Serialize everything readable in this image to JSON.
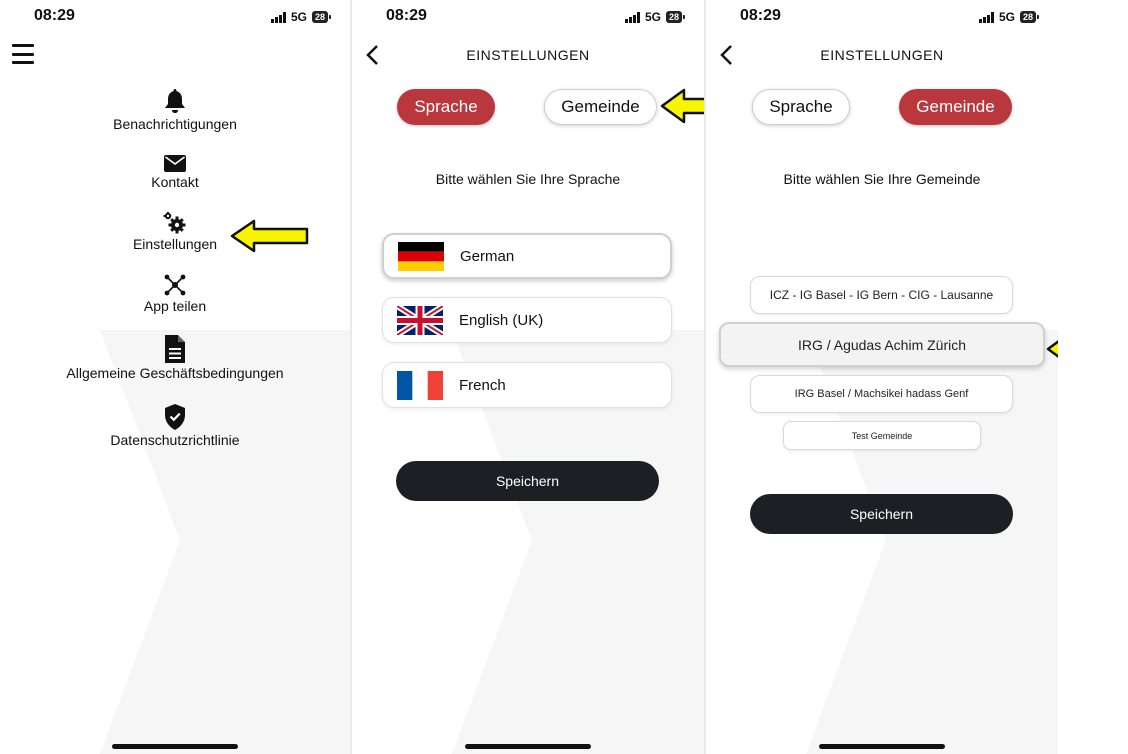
{
  "status_bar": {
    "time": "08:29",
    "network": "5G",
    "battery": "28"
  },
  "screen1": {
    "menu": [
      {
        "label": "Benachrichtigungen",
        "icon": "bell-icon"
      },
      {
        "label": "Kontakt",
        "icon": "envelope-icon"
      },
      {
        "label": "Einstellungen",
        "icon": "gears-icon"
      },
      {
        "label": "App teilen",
        "icon": "share-nodes-icon"
      },
      {
        "label": "Allgemeine Geschäftsbedingungen",
        "icon": "document-icon"
      },
      {
        "label": "Datenschutzrichtlinie",
        "icon": "shield-check-icon"
      }
    ]
  },
  "screen2": {
    "title": "EINSTELLUNGEN",
    "tabs": {
      "language": "Sprache",
      "community": "Gemeinde"
    },
    "prompt": "Bitte wählen Sie Ihre Sprache",
    "languages": [
      {
        "name": "German",
        "flag": "de-flag"
      },
      {
        "name": "English (UK)",
        "flag": "uk-flag"
      },
      {
        "name": "French",
        "flag": "fr-flag"
      }
    ],
    "selected_language": "German",
    "save_label": "Speichern"
  },
  "screen3": {
    "title": "EINSTELLUNGEN",
    "tabs": {
      "language": "Sprache",
      "community": "Gemeinde"
    },
    "prompt": "Bitte wählen Sie Ihre Gemeinde",
    "communities": [
      "ICZ - IG Basel - IG Bern - CIG - Lausanne",
      "IRG / Agudas Achim Zürich",
      "IRG Basel / Machsikei hadass Genf",
      "Test Gemeinde"
    ],
    "selected_community": "IRG / Agudas Achim Zürich",
    "save_label": "Speichern"
  },
  "colors": {
    "accent_red": "#b9373d",
    "button_dark": "#1c1f24",
    "highlight_arrow": "#f7f500"
  }
}
